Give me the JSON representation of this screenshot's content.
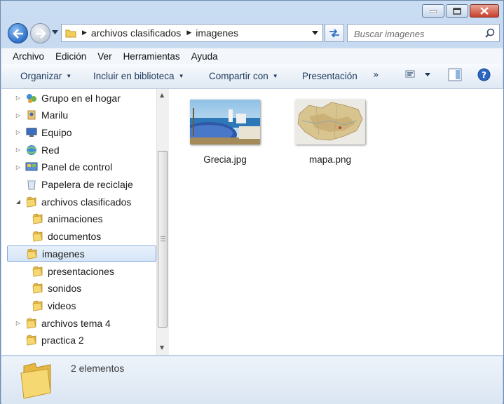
{
  "window": {
    "colors": {
      "accent": "#2d6fc6",
      "close": "#c7402b",
      "selection": "#d5e5f7"
    }
  },
  "address": {
    "crumbs": [
      "archivos clasificados",
      "imagenes"
    ]
  },
  "search": {
    "placeholder": "Buscar imagenes"
  },
  "menu": [
    "Archivo",
    "Edición",
    "Ver",
    "Herramientas",
    "Ayuda"
  ],
  "toolbar": {
    "organize": "Organizar",
    "library": "Incluir en biblioteca",
    "share": "Compartir con",
    "presentation": "Presentación",
    "more": "»"
  },
  "tree": [
    {
      "label": "Grupo en el hogar",
      "icon": "homegroup-icon",
      "expander": "closed"
    },
    {
      "label": "Marilu",
      "icon": "user-icon",
      "expander": "closed"
    },
    {
      "label": "Equipo",
      "icon": "computer-icon",
      "expander": "closed"
    },
    {
      "label": "Red",
      "icon": "network-icon",
      "expander": "closed"
    },
    {
      "label": "Panel de control",
      "icon": "control-panel-icon",
      "expander": "closed"
    },
    {
      "label": "Papelera de reciclaje",
      "icon": "recycle-bin-icon",
      "expander": "none"
    },
    {
      "label": "archivos clasificados",
      "icon": "folder-icon",
      "expander": "open"
    },
    {
      "label": "animaciones",
      "icon": "folder-icon",
      "expander": "none"
    },
    {
      "label": "documentos",
      "icon": "folder-icon",
      "expander": "none"
    },
    {
      "label": "imagenes",
      "icon": "folder-icon",
      "expander": "none",
      "selected": true
    },
    {
      "label": "presentaciones",
      "icon": "folder-icon",
      "expander": "none"
    },
    {
      "label": "sonidos",
      "icon": "folder-icon",
      "expander": "none"
    },
    {
      "label": "videos",
      "icon": "folder-icon",
      "expander": "none"
    },
    {
      "label": "archivos tema 4",
      "icon": "folder-icon",
      "expander": "closed"
    },
    {
      "label": "practica 2",
      "icon": "folder-icon",
      "expander": "none"
    }
  ],
  "files": [
    {
      "name": "Grecia.jpg",
      "thumb": "greece-photo-thumbnail"
    },
    {
      "name": "mapa.png",
      "thumb": "map-thumbnail"
    }
  ],
  "details": {
    "count": "2 elementos"
  }
}
